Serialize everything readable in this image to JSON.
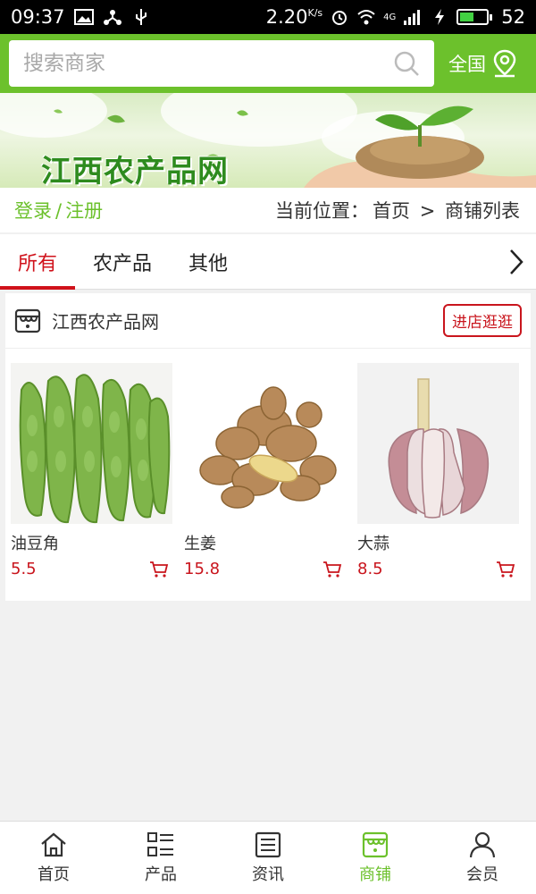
{
  "status_bar": {
    "time": "09:37",
    "network_speed": "2.20",
    "network_speed_unit": "K/s",
    "network_type": "4G",
    "battery": "52",
    "battery_level": 0.52
  },
  "header": {
    "search_placeholder": "搜索商家",
    "region_label": "全国"
  },
  "banner": {
    "title": "江西农产品网"
  },
  "crumb": {
    "login": "登录",
    "separator": "/",
    "register": "注册",
    "location_label": "当前位置：",
    "home": "首页",
    "arrow": ">",
    "current": "商铺列表"
  },
  "tabs": [
    {
      "label": "所有",
      "active": true
    },
    {
      "label": "农产品",
      "active": false
    },
    {
      "label": "其他",
      "active": false
    }
  ],
  "store": {
    "name": "江西农产品网",
    "visit_label": "进店逛逛",
    "products": [
      {
        "name": "油豆角",
        "price": "5.5",
        "image": "green-beans"
      },
      {
        "name": "生姜",
        "price": "15.8",
        "image": "ginger"
      },
      {
        "name": "大蒜",
        "price": "8.5",
        "image": "garlic"
      }
    ]
  },
  "bottom_nav": [
    {
      "label": "首页",
      "icon": "home-icon",
      "active": false
    },
    {
      "label": "产品",
      "icon": "grid-list-icon",
      "active": false
    },
    {
      "label": "资讯",
      "icon": "news-icon",
      "active": false
    },
    {
      "label": "商铺",
      "icon": "store-icon",
      "active": true
    },
    {
      "label": "会员",
      "icon": "user-icon",
      "active": false
    }
  ],
  "colors": {
    "brand_green": "#6cc12c",
    "accent_red": "#d0121b"
  }
}
